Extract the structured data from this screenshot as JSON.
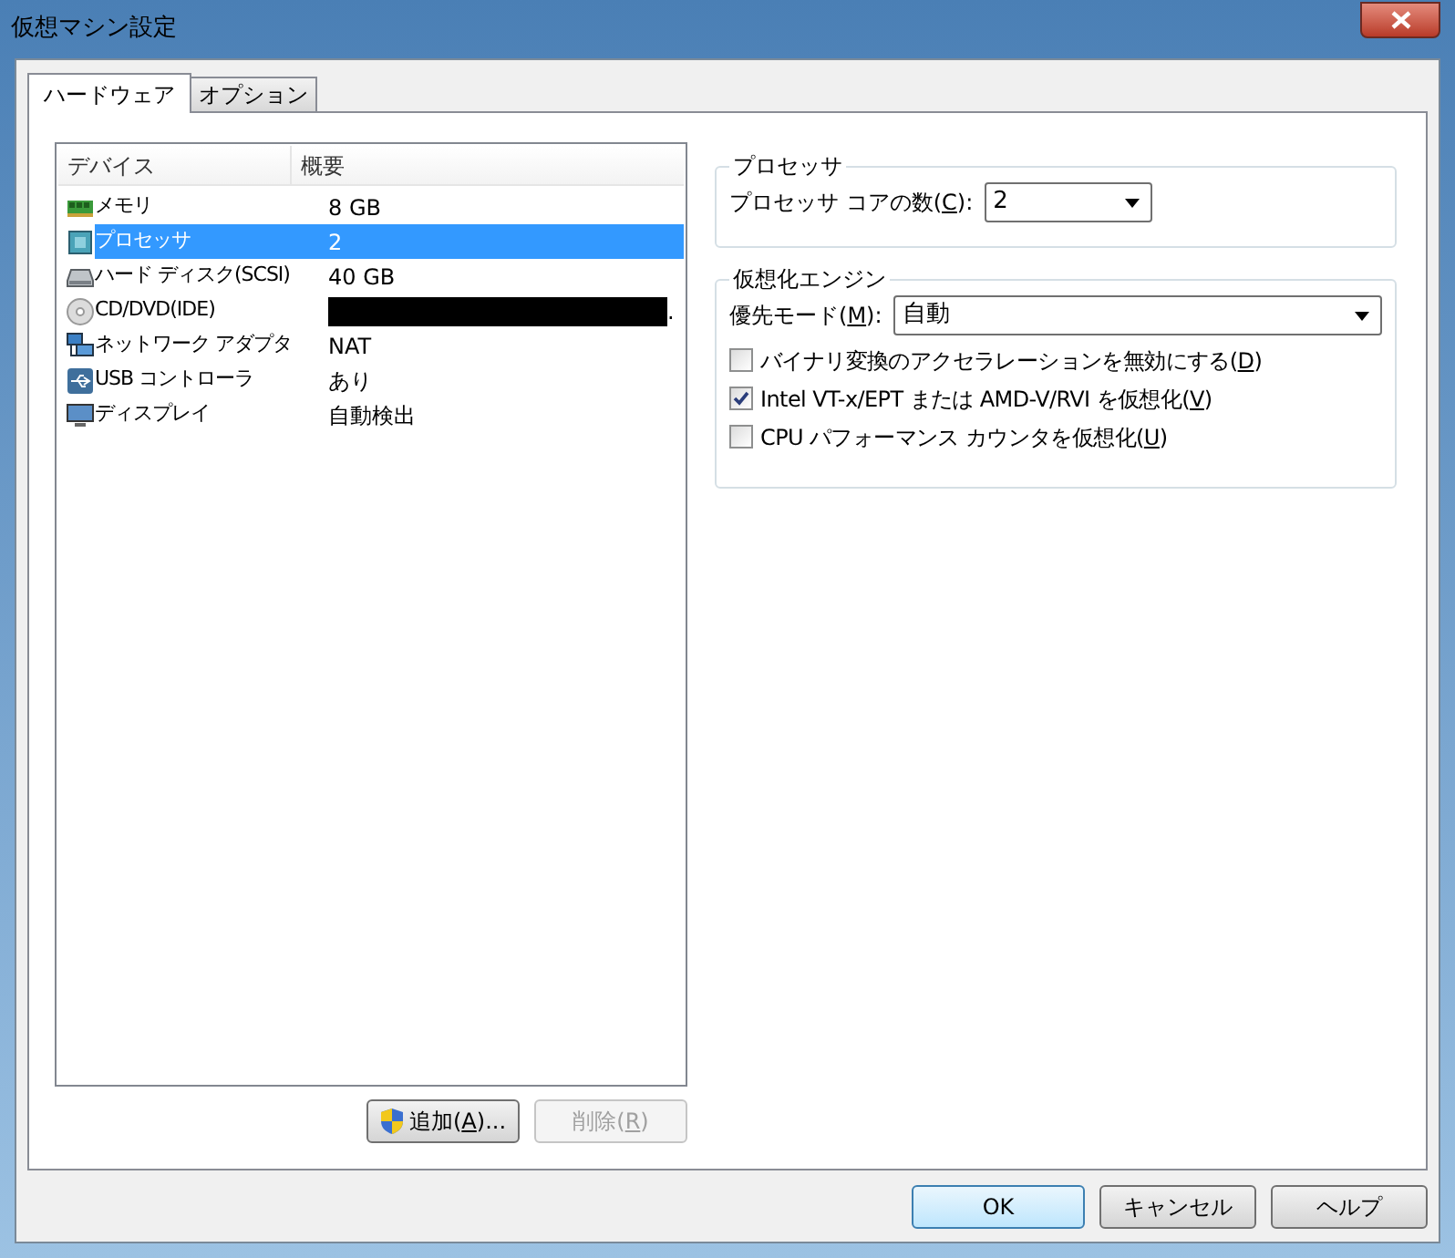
{
  "window": {
    "title": "仮想マシン設定"
  },
  "tabs": [
    {
      "label": "ハードウェア",
      "selected": true
    },
    {
      "label": "オプション",
      "selected": false
    }
  ],
  "device_list": {
    "columns": [
      "デバイス",
      "概要"
    ],
    "rows": [
      {
        "kind": "memory",
        "device": "メモリ",
        "summary": "8 GB",
        "selected": false
      },
      {
        "kind": "processor",
        "device": "プロセッサ",
        "summary": "2",
        "selected": true
      },
      {
        "kind": "disk",
        "device": "ハード ディスク(SCSI)",
        "summary": "40 GB",
        "selected": false
      },
      {
        "kind": "cd",
        "device": "CD/DVD(IDE)",
        "summary": ".",
        "redacted": true,
        "selected": false
      },
      {
        "kind": "network",
        "device": "ネットワーク アダプタ",
        "summary": "NAT",
        "selected": false
      },
      {
        "kind": "usb",
        "device": "USB コントローラ",
        "summary": "あり",
        "selected": false
      },
      {
        "kind": "display",
        "device": "ディスプレイ",
        "summary": "自動検出",
        "selected": false
      }
    ]
  },
  "list_buttons": [
    {
      "before": "追加(",
      "mnemonic": "A",
      "after": ")...",
      "shield": true,
      "disabled": false
    },
    {
      "before": "削除(",
      "mnemonic": "R",
      "after": ")",
      "shield": false,
      "disabled": true
    }
  ],
  "processor_group": {
    "title": "プロセッサ",
    "field": {
      "before": "プロセッサ コアの数(",
      "mnemonic": "C",
      "after": "):",
      "value": "2"
    }
  },
  "engine_group": {
    "title": "仮想化エンジン",
    "field": {
      "before": "優先モード(",
      "mnemonic": "M",
      "after": "):",
      "value": "自動"
    },
    "options": [
      {
        "before": "バイナリ変換のアクセラレーションを無効にする(",
        "mnemonic": "D",
        "after": ")",
        "checked": false
      },
      {
        "before": "Intel VT-x/EPT または AMD-V/RVI を仮想化(",
        "mnemonic": "V",
        "after": ")",
        "checked": true
      },
      {
        "before": "CPU パフォーマンス カウンタを仮想化(",
        "mnemonic": "U",
        "after": ")",
        "checked": false
      }
    ]
  },
  "dialog_buttons": [
    {
      "label": "OK",
      "default": true
    },
    {
      "label": "キャンセル",
      "default": false
    },
    {
      "label": "ヘルプ",
      "default": false
    }
  ]
}
